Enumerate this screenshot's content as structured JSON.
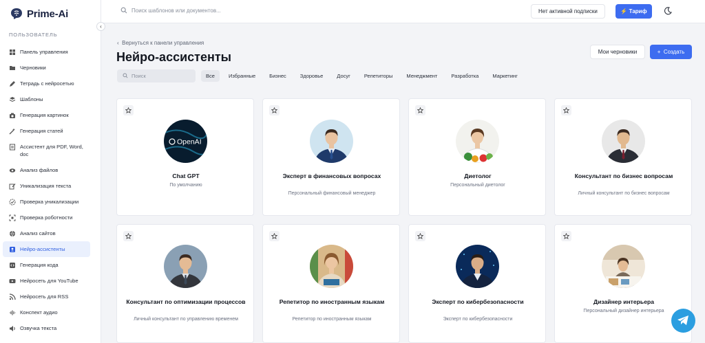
{
  "brand": {
    "name": "Prime-Ai",
    "color": "#3d6cf0"
  },
  "sidebar": {
    "section": "ПОЛЬЗОВАТЕЛЬ",
    "items": [
      {
        "label": "Панель управления",
        "icon": "dashboard-icon"
      },
      {
        "label": "Черновики",
        "icon": "folder-icon"
      },
      {
        "label": "Тетрадь с нейросетью",
        "icon": "pen-icon"
      },
      {
        "label": "Шаблоны",
        "icon": "layers-icon"
      },
      {
        "label": "Генерация картинок",
        "icon": "camera-icon"
      },
      {
        "label": "Генерация статей",
        "icon": "magic-icon"
      },
      {
        "label": "Ассистент для PDF, Word, doc",
        "icon": "document-icon"
      },
      {
        "label": "Анализ файлов",
        "icon": "eye-icon"
      },
      {
        "label": "Уникализация текста",
        "icon": "edit-icon"
      },
      {
        "label": "Проверка уникализации",
        "icon": "check-circle-icon"
      },
      {
        "label": "Проверка роботности",
        "icon": "scan-icon"
      },
      {
        "label": "Анализ сайтов",
        "icon": "globe-icon"
      },
      {
        "label": "Нейро-ассистенты",
        "icon": "user-card-icon",
        "active": true
      },
      {
        "label": "Генерация кода",
        "icon": "code-icon"
      },
      {
        "label": "Нейросеть для YouTube",
        "icon": "youtube-icon"
      },
      {
        "label": "Нейросеть для RSS",
        "icon": "rss-icon"
      },
      {
        "label": "Конспект аудио",
        "icon": "audio-wave-icon"
      },
      {
        "label": "Озвучка текста",
        "icon": "speaker-icon"
      }
    ]
  },
  "topbar": {
    "search_placeholder": "Поиск шаблонов или документов...",
    "subscription": "Нет активной подписки",
    "tariff": "Тариф"
  },
  "main": {
    "back": "Вернуться к панели управления",
    "title": "Нейро-ассистенты",
    "drafts": "Мои черновики",
    "create": "Создать",
    "search_placeholder": "Поиск",
    "filters": [
      "Все",
      "Избранные",
      "Бизнес",
      "Здоровье",
      "Досуг",
      "Репетиторы",
      "Менеджмент",
      "Разработка",
      "Маркетинг"
    ],
    "active_filter": 0
  },
  "cards": [
    {
      "title": "Chat GPT",
      "desc": "По умолчанию",
      "avatar_text": "OpenAI",
      "kind": "openai"
    },
    {
      "title": "Эксперт в финансовых вопросах",
      "desc": "Персональный финансовый менеджер",
      "kind": "finance"
    },
    {
      "title": "Диетолог",
      "desc": "Персональный диетолог",
      "kind": "diet"
    },
    {
      "title": "Консультант по бизнес вопросам",
      "desc": "Личный консультант по бизнес вопросам",
      "kind": "business"
    },
    {
      "title": "Консультант по оптимизации процессов",
      "desc": "Личный консультант по управлению временем",
      "kind": "optim"
    },
    {
      "title": "Репетитор по иностранным языкам",
      "desc": "Репетитор по иностранным языкам",
      "kind": "tutor"
    },
    {
      "title": "Эксперт по кибербезопасности",
      "desc": "Эксперт по кибербезопасности",
      "kind": "cyber"
    },
    {
      "title": "Дизайнер интерьера",
      "desc": "Персональный дизайнер интерьера",
      "kind": "interior"
    }
  ]
}
